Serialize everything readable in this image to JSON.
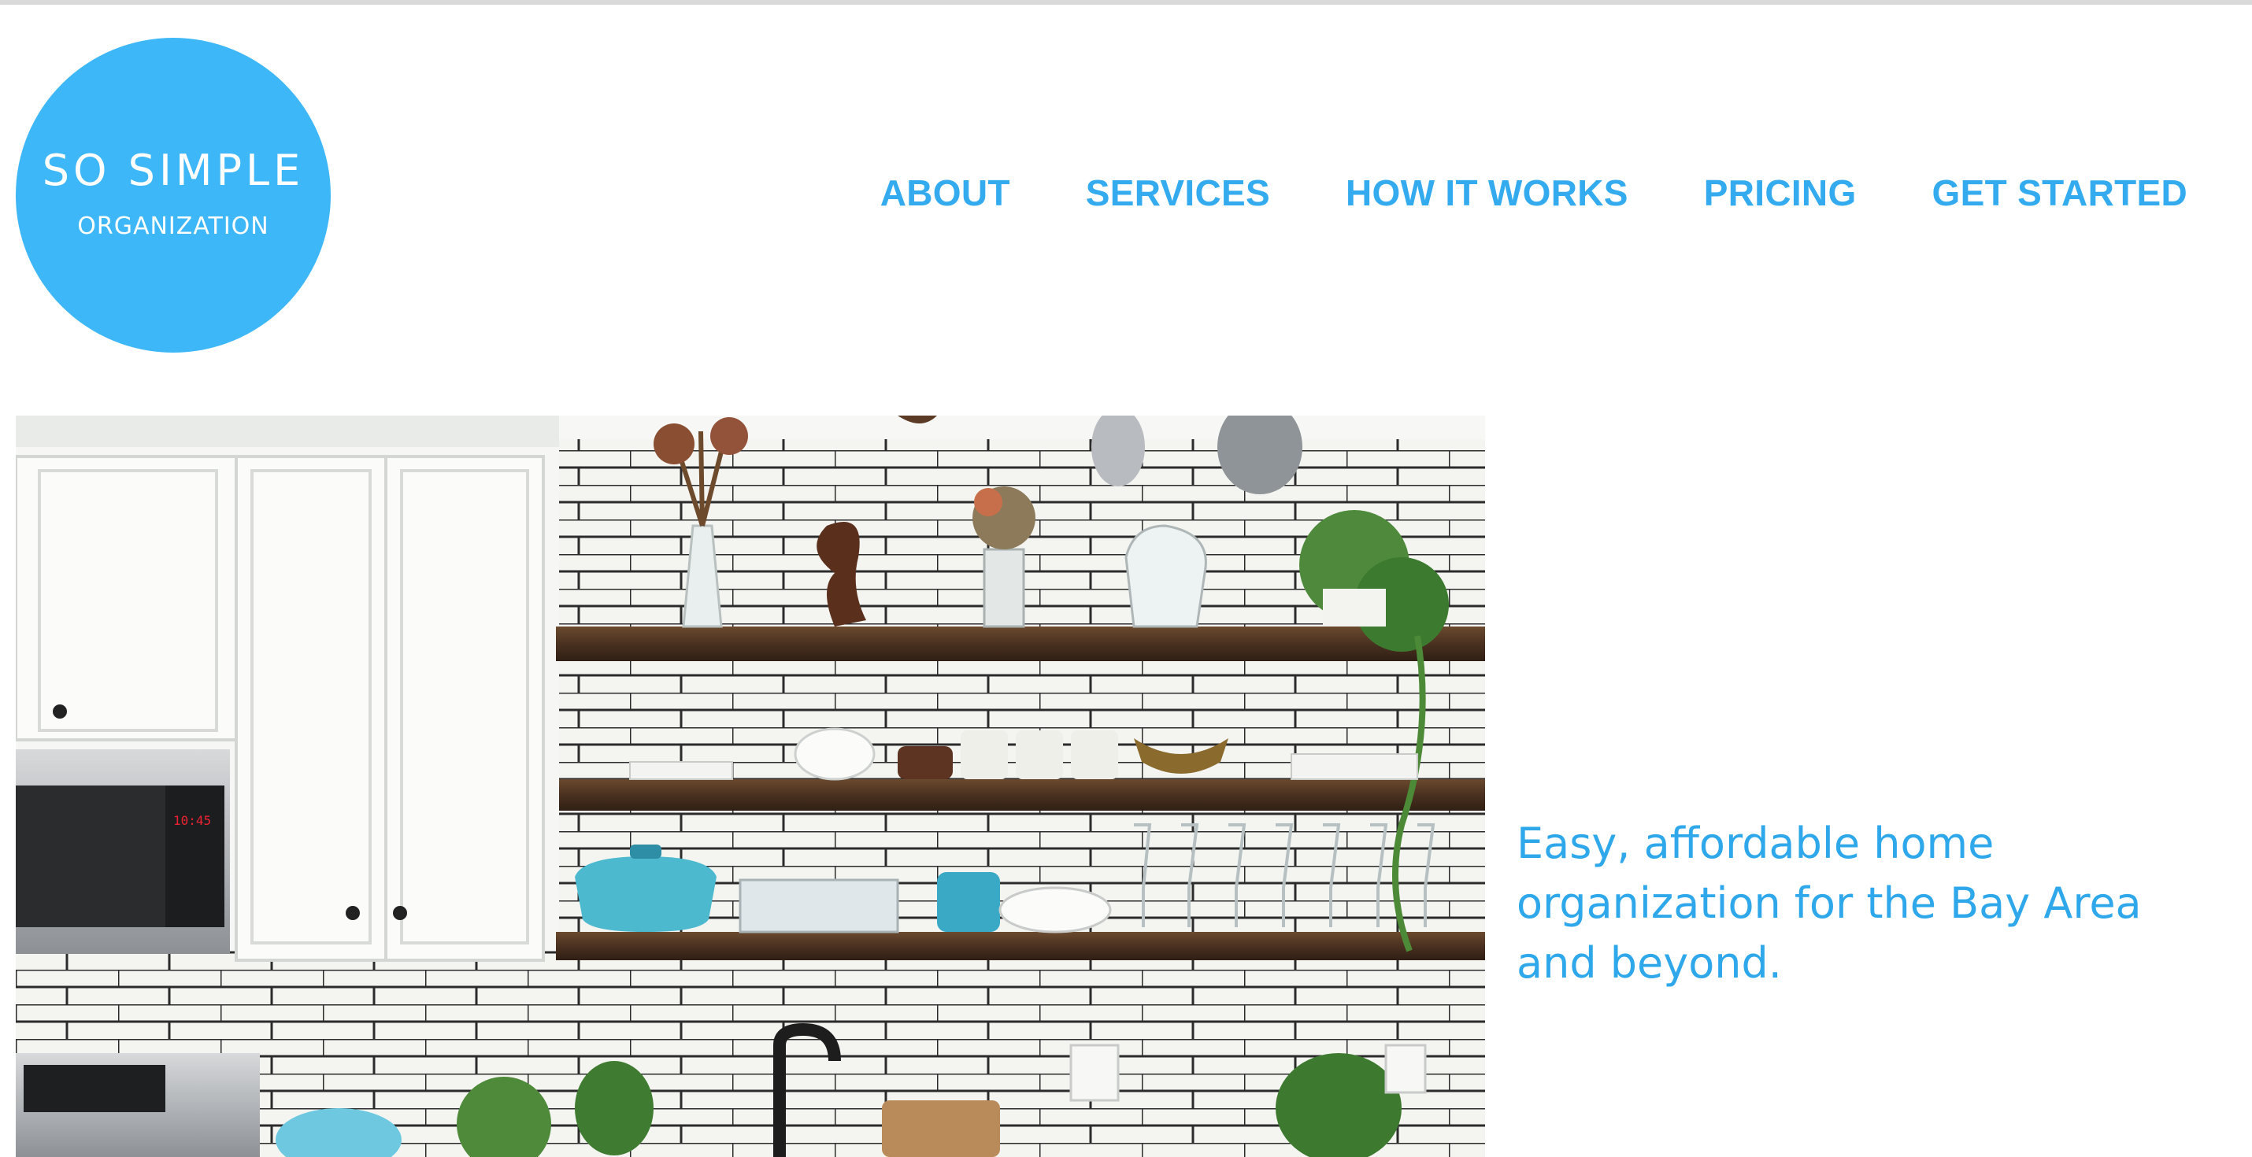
{
  "brand": {
    "name": "SO SIMPLE",
    "tagline_small": "ORGANIZATION",
    "color": "#3db7f7"
  },
  "nav": {
    "items": [
      "ABOUT",
      "SERVICES",
      "HOW IT WORKS",
      "PRICING",
      "GET STARTED"
    ],
    "color": "#33abee"
  },
  "hero": {
    "image": "kitchen-shelves-photo",
    "tagline": "Easy, affordable home organization for the Bay Area and beyond."
  }
}
